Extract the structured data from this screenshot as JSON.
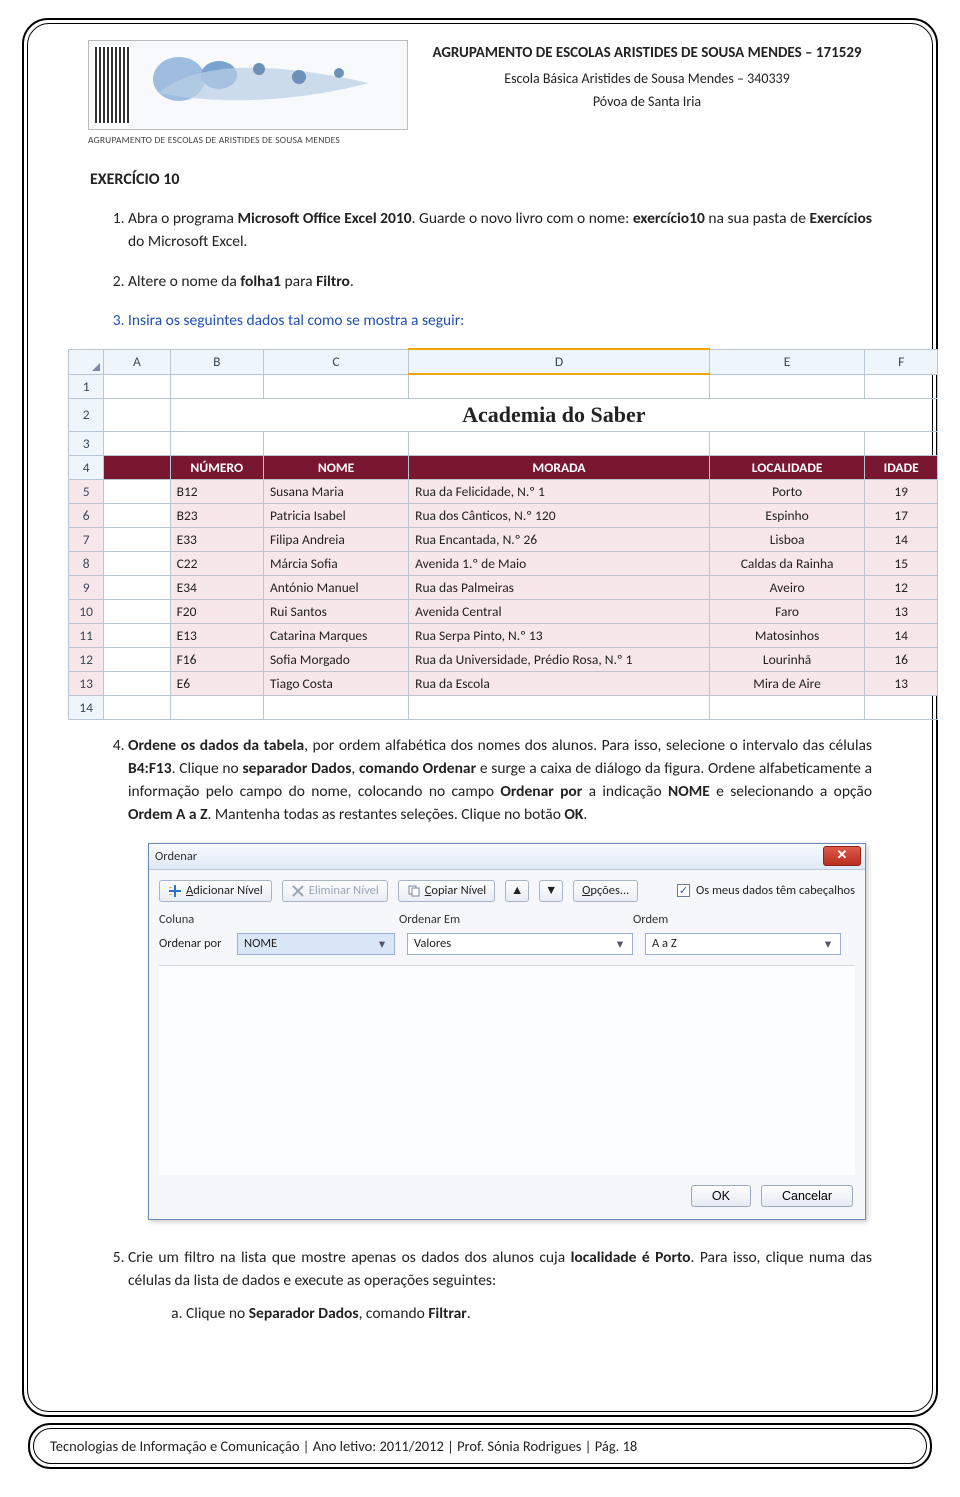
{
  "header": {
    "logo_caption": "AGRUPAMENTO DE ESCOLAS DE ARISTIDES DE SOUSA MENDES",
    "line1": "AGRUPAMENTO DE ESCOLAS ARISTIDES DE SOUSA MENDES – 171529",
    "line2": "Escola Básica Aristides de Sousa Mendes – 340339",
    "line3": "Póvoa de Santa Iria"
  },
  "exercise_title": "EXERCÍCIO 10",
  "steps": {
    "s1_a": "Abra o programa ",
    "s1_b": "Microsoft Office Excel 2010",
    "s1_c": ". Guarde o novo livro com o nome: ",
    "s1_d": "exercício10",
    "s1_e": " na sua pasta de ",
    "s1_f": "Exercícios",
    "s1_g": " do Microsoft Excel.",
    "s2_a": "Altere o nome da ",
    "s2_b": "folha1",
    "s2_c": " para ",
    "s2_d": "Filtro",
    "s2_e": ".",
    "s3": "Insira os seguintes dados tal como se mostra a seguir:",
    "s4_a": "Ordene os dados da tabela",
    "s4_b": ", por ordem alfabética dos nomes dos alunos. Para isso, selecione o intervalo das células ",
    "s4_c": "B4:F13",
    "s4_d": ". Clique no ",
    "s4_e": "separador Dados",
    "s4_f": ", ",
    "s4_g": "comando Ordenar",
    "s4_h": " e surge a caixa de diálogo da figura. Ordene alfabeticamente a informação pelo campo do nome, colocando no campo ",
    "s4_i": "Ordenar por",
    "s4_j": " a indicação ",
    "s4_k": "NOME",
    "s4_l": " e selecionando a opção ",
    "s4_m": "Ordem A a Z",
    "s4_n": ". Mantenha todas as restantes seleções. Clique no botão ",
    "s4_o": "OK",
    "s4_p": ".",
    "s5_a": "Crie um filtro na lista que mostre apenas os dados dos alunos cuja ",
    "s5_b": "localidade é Porto",
    "s5_c": ". Para isso, clique numa das células da lista de dados e execute as operações seguintes:",
    "s5a_a": "Clique no ",
    "s5a_b": "Separador Dados",
    "s5a_c": ", comando ",
    "s5a_d": "Filtrar",
    "s5a_e": "."
  },
  "excel": {
    "cols": [
      "A",
      "B",
      "C",
      "D",
      "E",
      "F"
    ],
    "row_numbers": [
      "1",
      "2",
      "3",
      "4",
      "5",
      "6",
      "7",
      "8",
      "9",
      "10",
      "11",
      "12",
      "13",
      "14"
    ],
    "title": "Academia do Saber",
    "headers": [
      "NÚMERO",
      "NOME",
      "MORADA",
      "LOCALIDADE",
      "IDADE"
    ],
    "rows": [
      {
        "b": "B12",
        "c": "Susana Maria",
        "d": "Rua da Felicidade, N.º 1",
        "e": "Porto",
        "f": "19"
      },
      {
        "b": "B23",
        "c": "Patricia Isabel",
        "d": "Rua dos Cânticos, N.º 120",
        "e": "Espinho",
        "f": "17"
      },
      {
        "b": "E33",
        "c": "Filipa Andreia",
        "d": "Rua Encantada, N.º 26",
        "e": "Lisboa",
        "f": "14"
      },
      {
        "b": "C22",
        "c": "Márcia Sofia",
        "d": "Avenida 1.º de Maio",
        "e": "Caldas da Rainha",
        "f": "15"
      },
      {
        "b": "E34",
        "c": "António Manuel",
        "d": "Rua das Palmeiras",
        "e": "Aveiro",
        "f": "12"
      },
      {
        "b": "F20",
        "c": "Rui Santos",
        "d": "Avenida Central",
        "e": "Faro",
        "f": "13"
      },
      {
        "b": "E13",
        "c": "Catarina Marques",
        "d": "Rua Serpa Pinto, N.º 13",
        "e": "Matosinhos",
        "f": "14"
      },
      {
        "b": "F16",
        "c": "Sofia Morgado",
        "d": "Rua da Universidade, Prédio Rosa, N.º 1",
        "e": "Lourinhã",
        "f": "16"
      },
      {
        "b": "E6",
        "c": "Tiago Costa",
        "d": "Rua da Escola",
        "e": "Mira de Aire",
        "f": "13"
      }
    ]
  },
  "dialog": {
    "title": "Ordenar",
    "add_pre": "A",
    "add_post": "dicionar Nível",
    "del": "Eliminar Nível",
    "copy_pre": "C",
    "copy_post": "opiar Nível",
    "options_pre": "O",
    "options_post": "pções...",
    "headers_chk_pre": "O",
    "headers_chk_post": "s meus dados têm cabeçalhos",
    "col_col": "Coluna",
    "col_on": "Ordenar Em",
    "col_ord": "Ordem",
    "row_lbl": "Ordenar por",
    "combo_col": "NOME",
    "combo_on": "Valores",
    "combo_ord": "A a Z",
    "ok": "OK",
    "cancel": "Cancelar"
  },
  "footer": "Tecnologias de Informação e Comunicação | Ano letivo: 2011/2012 | Prof. Sónia Rodrigues | Pág. 18"
}
